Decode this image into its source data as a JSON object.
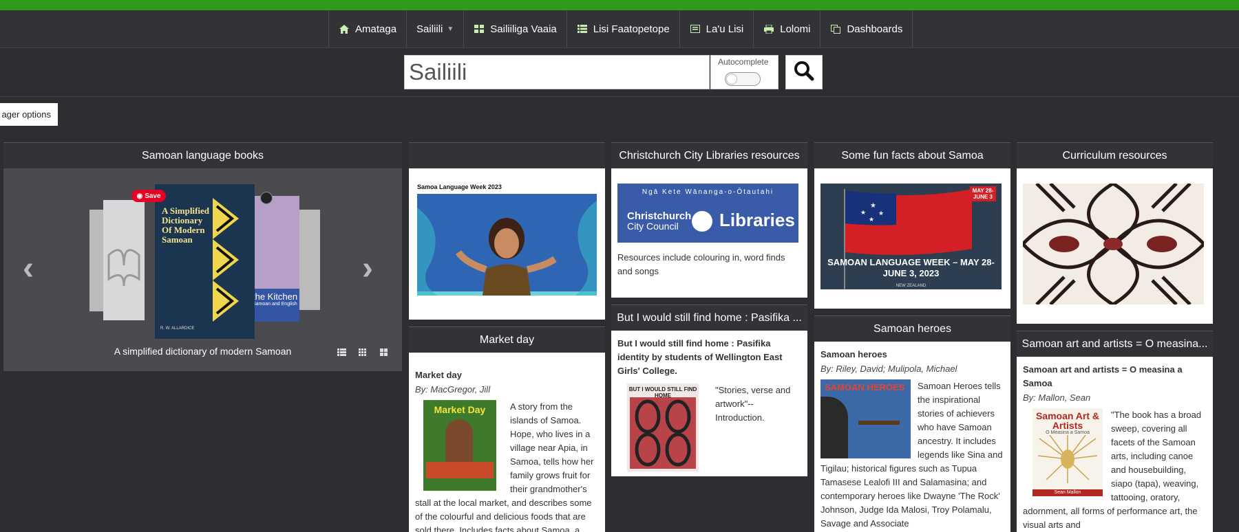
{
  "nav": {
    "items": [
      {
        "label": "Amataga",
        "icon": "home-icon"
      },
      {
        "label": "Sailiili",
        "icon": "",
        "dropdown": true
      },
      {
        "label": "Sailiiliga Vaaia",
        "icon": "grid-icon"
      },
      {
        "label": "Lisi Faatopetope",
        "icon": "list-icon"
      },
      {
        "label": "La'u Lisi",
        "icon": "list-box-icon"
      },
      {
        "label": "Lolomi",
        "icon": "print-icon"
      },
      {
        "label": "Dashboards",
        "icon": "dashboard-icon"
      }
    ]
  },
  "search": {
    "placeholder": "Sailiili",
    "autocomplete_label": "Autocomplete"
  },
  "pager": {
    "label": "ager options"
  },
  "carousel": {
    "title": "Samoan language books",
    "caption": "A simplified dictionary of modern Samoan",
    "book_title": "A Simplified Dictionary Of Modern Samoan",
    "book_author": "R. W. ALLARDICE",
    "side_book_title": "the Kitchen",
    "side_book_sub": "Samoan and English",
    "save_label": "Save"
  },
  "widgets": {
    "language_week": {
      "title": "",
      "image_text": "Samoa Language Week 2023"
    },
    "market_day": {
      "title": "Market day",
      "book_title": "Market day",
      "by": "By: MacGregor, Jill",
      "cover_title": "Market Day",
      "desc": "A story from the islands of Samoa. Hope, who lives in a village near Apia, in Samoa, tells how her family grows fruit for their grandmother's stall at the local market, and describes some of the colourful and delicious foods that are sold there. Includes facts about Samoa, a"
    },
    "ccl": {
      "title": "Christchurch City Libraries resources",
      "banner_top": "Ngā Kete Wānanga-o-Ōtautahi",
      "banner_left1": "Christchurch",
      "banner_left2": "City Council",
      "banner_right": "Libraries",
      "desc": "Resources include colouring in, word finds and songs"
    },
    "home": {
      "title": "But I would still find home : Pasifika ...",
      "book_title": "But I would still find home : Pasifika identity by students of Wellington East Girls' College.",
      "cover_title": "BUT I WOULD STILL FIND HOME",
      "desc": "\"Stories, verse and artwork\"-- Introduction."
    },
    "facts": {
      "title": "Some fun facts about Samoa",
      "banner_date": "MAY 28-JUNE 3",
      "banner_text": "SAMOAN LANGUAGE WEEK – MAY 28-JUNE 3, 2023",
      "banner_sub": "NEW ZEALAND"
    },
    "heroes": {
      "title": "Samoan heroes",
      "book_title": "Samoan heroes",
      "by": "By: Riley, David; Mulipola, Michael",
      "cover_title": "SAMOAN HEROES",
      "desc": "Samoan Heroes tells the inspirational stories of achievers who have Samoan ancestry. It includes legends like Sina and Tigilau; historical figures such as Tupua Tamasese Lealofi III and Salamasina; and contemporary heroes like Dwayne 'The Rock' Johnson, Judge Ida Malosi, Troy Polamalu, Savage and Associate"
    },
    "curriculum": {
      "title": "Curriculum resources"
    },
    "art": {
      "title": "Samoan art and artists = O measina...",
      "book_title": "Samoan art and artists = O measina a Samoa",
      "by": "By: Mallon, Sean",
      "cover_title": "Samoan Art & Artists",
      "cover_sub": "O Measina a Samoa",
      "cover_author": "Sean Mallon",
      "desc": "\"The book has a broad sweep, covering all facets of the Samoan arts, including canoe and housebuilding, siapo (tapa), weaving, tattooing, oratory, adornment, all forms of performance art, the visual arts and"
    }
  }
}
